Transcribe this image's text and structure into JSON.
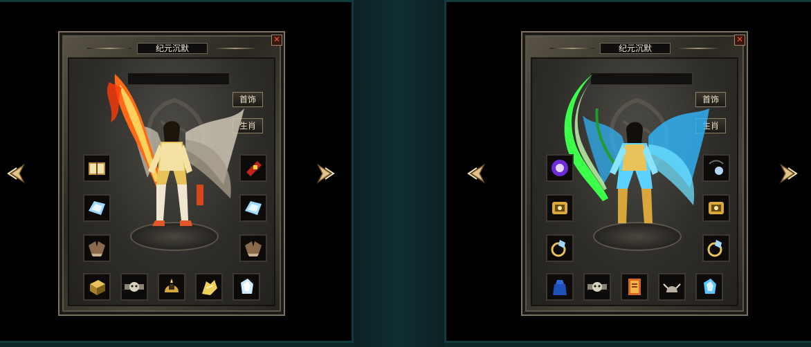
{
  "left_panel": {
    "title": "纪元沉默",
    "close_label": "✕",
    "buttons": {
      "jewelry": "首饰",
      "zodiac": "生肖"
    }
  },
  "right_panel": {
    "title": "纪元沉默",
    "close_label": "✕",
    "buttons": {
      "jewelry": "首饰",
      "zodiac": "生肖"
    }
  },
  "colors": {
    "left_accent": "#ff6a1a",
    "right_accent": "#2fe0ff",
    "right_weapon": "#3cff4a",
    "gold": "#e8c35a"
  }
}
